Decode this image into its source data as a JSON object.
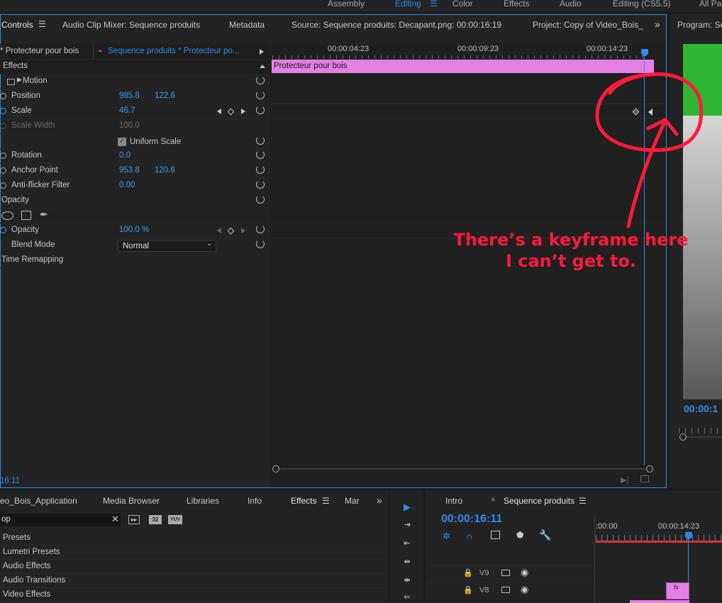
{
  "workspaces": [
    "Assembly",
    "Editing",
    "Color",
    "Effects",
    "Audio",
    "Editing (CS5.5)",
    "All Pa"
  ],
  "top_tabs": {
    "controls": "Controls",
    "audio_clip_mixer": "Audio Clip Mixer: Sequence produits",
    "metadata": "Metadata",
    "source": "Source: Sequence produits: Decapant.png: 00:00:16:19",
    "project": "Project: Copy of Video_Bois_",
    "program": "Program: Se"
  },
  "effect_controls": {
    "clip_master": "* Protecteur pour bois",
    "clip_sequence": "Sequence produits * Protecteur po...",
    "section_effects": "Effects",
    "motion": "Motion",
    "position_label": "Position",
    "position_x": "985.8",
    "position_y": "122.6",
    "scale_label": "Scale",
    "scale_value": "46.7",
    "scale_width_label": "Scale Width",
    "scale_width_value": "100.0",
    "uniform_scale_label": "Uniform Scale",
    "rotation_label": "Rotation",
    "rotation_value": "0.0",
    "anchor_label": "Anchor Point",
    "anchor_x": "953.8",
    "anchor_y": "120.6",
    "antiflicker_label": "Anti-flicker Filter",
    "antiflicker_value": "0.00",
    "opacity_section": "Opacity",
    "opacity_label": "Opacity",
    "opacity_value": "100.0 %",
    "blend_label": "Blend Mode",
    "blend_value": "Normal",
    "time_remap": "Time Remapping",
    "timecode": "16:11"
  },
  "mini_timeline": {
    "ruler": [
      "00:00:04:23",
      "00:00:09:23",
      "00:00:14:23"
    ],
    "clip_name": "Protecteur pour bois"
  },
  "program": {
    "timecode": "00:00:1"
  },
  "annotation": {
    "line1": "There’s a keyframe here",
    "line2": "I can’t get to."
  },
  "bottom_tabs": {
    "project": "eo_Bois_Application",
    "media_browser": "Media Browser",
    "libraries": "Libraries",
    "info": "Info",
    "effects": "Effects",
    "markers": "Mar"
  },
  "effects_panel": {
    "search_value": "op",
    "badge_32": "32",
    "badge_yuv": "YUV",
    "items": [
      "Presets",
      "Lumetri Presets",
      "Audio Effects",
      "Audio Transitions",
      "Video Effects"
    ]
  },
  "sequence": {
    "tab_intro": "Intro",
    "tab_sequence": "Sequence produits",
    "timecode": "00:00:16:11",
    "ruler": [
      ":00:00",
      "00:00:14:23"
    ],
    "tracks": [
      "V9",
      "V8"
    ],
    "clip_fx": "fx"
  },
  "colors": {
    "accent": "#2d8ceb",
    "clip_pink": "#e47fe6",
    "annotation_red": "#ff1a3c",
    "program_green": "#2eb531"
  }
}
